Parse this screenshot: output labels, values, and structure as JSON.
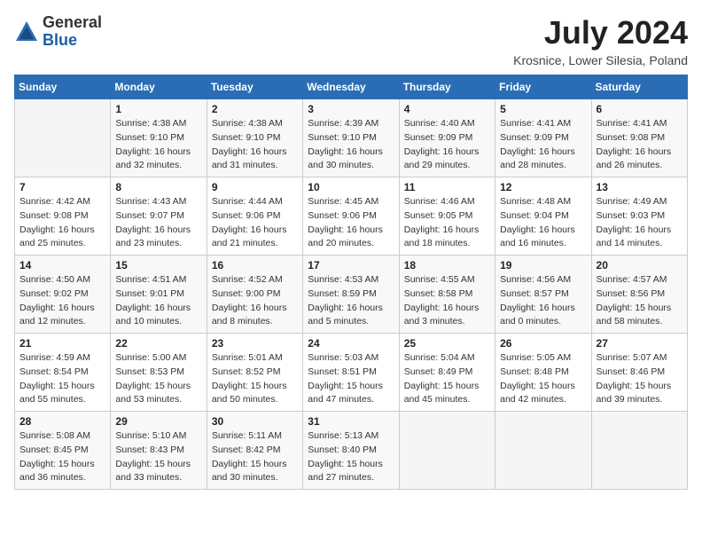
{
  "header": {
    "logo_line1": "General",
    "logo_line2": "Blue",
    "month": "July 2024",
    "location": "Krosnice, Lower Silesia, Poland"
  },
  "days_of_week": [
    "Sunday",
    "Monday",
    "Tuesday",
    "Wednesday",
    "Thursday",
    "Friday",
    "Saturday"
  ],
  "weeks": [
    [
      {
        "day": "",
        "info": ""
      },
      {
        "day": "1",
        "info": "Sunrise: 4:38 AM\nSunset: 9:10 PM\nDaylight: 16 hours\nand 32 minutes."
      },
      {
        "day": "2",
        "info": "Sunrise: 4:38 AM\nSunset: 9:10 PM\nDaylight: 16 hours\nand 31 minutes."
      },
      {
        "day": "3",
        "info": "Sunrise: 4:39 AM\nSunset: 9:10 PM\nDaylight: 16 hours\nand 30 minutes."
      },
      {
        "day": "4",
        "info": "Sunrise: 4:40 AM\nSunset: 9:09 PM\nDaylight: 16 hours\nand 29 minutes."
      },
      {
        "day": "5",
        "info": "Sunrise: 4:41 AM\nSunset: 9:09 PM\nDaylight: 16 hours\nand 28 minutes."
      },
      {
        "day": "6",
        "info": "Sunrise: 4:41 AM\nSunset: 9:08 PM\nDaylight: 16 hours\nand 26 minutes."
      }
    ],
    [
      {
        "day": "7",
        "info": "Sunrise: 4:42 AM\nSunset: 9:08 PM\nDaylight: 16 hours\nand 25 minutes."
      },
      {
        "day": "8",
        "info": "Sunrise: 4:43 AM\nSunset: 9:07 PM\nDaylight: 16 hours\nand 23 minutes."
      },
      {
        "day": "9",
        "info": "Sunrise: 4:44 AM\nSunset: 9:06 PM\nDaylight: 16 hours\nand 21 minutes."
      },
      {
        "day": "10",
        "info": "Sunrise: 4:45 AM\nSunset: 9:06 PM\nDaylight: 16 hours\nand 20 minutes."
      },
      {
        "day": "11",
        "info": "Sunrise: 4:46 AM\nSunset: 9:05 PM\nDaylight: 16 hours\nand 18 minutes."
      },
      {
        "day": "12",
        "info": "Sunrise: 4:48 AM\nSunset: 9:04 PM\nDaylight: 16 hours\nand 16 minutes."
      },
      {
        "day": "13",
        "info": "Sunrise: 4:49 AM\nSunset: 9:03 PM\nDaylight: 16 hours\nand 14 minutes."
      }
    ],
    [
      {
        "day": "14",
        "info": "Sunrise: 4:50 AM\nSunset: 9:02 PM\nDaylight: 16 hours\nand 12 minutes."
      },
      {
        "day": "15",
        "info": "Sunrise: 4:51 AM\nSunset: 9:01 PM\nDaylight: 16 hours\nand 10 minutes."
      },
      {
        "day": "16",
        "info": "Sunrise: 4:52 AM\nSunset: 9:00 PM\nDaylight: 16 hours\nand 8 minutes."
      },
      {
        "day": "17",
        "info": "Sunrise: 4:53 AM\nSunset: 8:59 PM\nDaylight: 16 hours\nand 5 minutes."
      },
      {
        "day": "18",
        "info": "Sunrise: 4:55 AM\nSunset: 8:58 PM\nDaylight: 16 hours\nand 3 minutes."
      },
      {
        "day": "19",
        "info": "Sunrise: 4:56 AM\nSunset: 8:57 PM\nDaylight: 16 hours\nand 0 minutes."
      },
      {
        "day": "20",
        "info": "Sunrise: 4:57 AM\nSunset: 8:56 PM\nDaylight: 15 hours\nand 58 minutes."
      }
    ],
    [
      {
        "day": "21",
        "info": "Sunrise: 4:59 AM\nSunset: 8:54 PM\nDaylight: 15 hours\nand 55 minutes."
      },
      {
        "day": "22",
        "info": "Sunrise: 5:00 AM\nSunset: 8:53 PM\nDaylight: 15 hours\nand 53 minutes."
      },
      {
        "day": "23",
        "info": "Sunrise: 5:01 AM\nSunset: 8:52 PM\nDaylight: 15 hours\nand 50 minutes."
      },
      {
        "day": "24",
        "info": "Sunrise: 5:03 AM\nSunset: 8:51 PM\nDaylight: 15 hours\nand 47 minutes."
      },
      {
        "day": "25",
        "info": "Sunrise: 5:04 AM\nSunset: 8:49 PM\nDaylight: 15 hours\nand 45 minutes."
      },
      {
        "day": "26",
        "info": "Sunrise: 5:05 AM\nSunset: 8:48 PM\nDaylight: 15 hours\nand 42 minutes."
      },
      {
        "day": "27",
        "info": "Sunrise: 5:07 AM\nSunset: 8:46 PM\nDaylight: 15 hours\nand 39 minutes."
      }
    ],
    [
      {
        "day": "28",
        "info": "Sunrise: 5:08 AM\nSunset: 8:45 PM\nDaylight: 15 hours\nand 36 minutes."
      },
      {
        "day": "29",
        "info": "Sunrise: 5:10 AM\nSunset: 8:43 PM\nDaylight: 15 hours\nand 33 minutes."
      },
      {
        "day": "30",
        "info": "Sunrise: 5:11 AM\nSunset: 8:42 PM\nDaylight: 15 hours\nand 30 minutes."
      },
      {
        "day": "31",
        "info": "Sunrise: 5:13 AM\nSunset: 8:40 PM\nDaylight: 15 hours\nand 27 minutes."
      },
      {
        "day": "",
        "info": ""
      },
      {
        "day": "",
        "info": ""
      },
      {
        "day": "",
        "info": ""
      }
    ]
  ]
}
